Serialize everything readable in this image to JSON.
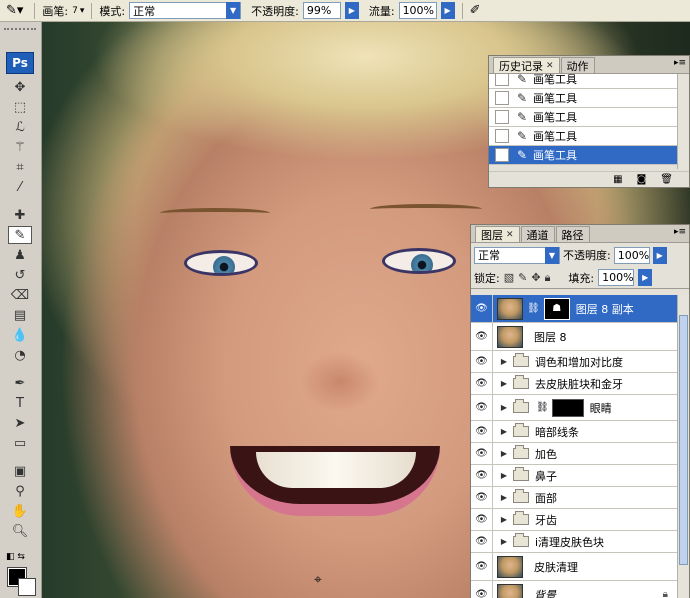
{
  "options_bar": {
    "brush_label": "画笔:",
    "brush_size": "7",
    "mode_label": "模式:",
    "mode_value": "正常",
    "opacity_label": "不透明度:",
    "opacity_value": "99%",
    "flow_label": "流量:",
    "flow_value": "100%"
  },
  "toolbox": {
    "logo": "Ps"
  },
  "history_panel": {
    "tabs": [
      {
        "label": "历史记录",
        "active": true
      },
      {
        "label": "动作",
        "active": false
      }
    ],
    "items": [
      {
        "label": "画笔工具",
        "selected": false
      },
      {
        "label": "画笔工具",
        "selected": false
      },
      {
        "label": "画笔工具",
        "selected": false
      },
      {
        "label": "画笔工具",
        "selected": false
      },
      {
        "label": "画笔工具",
        "selected": true
      }
    ]
  },
  "layers_panel": {
    "tabs": [
      {
        "label": "图层",
        "active": true
      },
      {
        "label": "通道",
        "active": false
      },
      {
        "label": "路径",
        "active": false
      }
    ],
    "blend_mode": "正常",
    "opacity_label": "不透明度:",
    "opacity_value": "100%",
    "lock_label": "锁定:",
    "fill_label": "填充:",
    "fill_value": "100%",
    "layers": [
      {
        "name": "图层 8 副本",
        "kind": "image-masked",
        "selected": true
      },
      {
        "name": "图层 8",
        "kind": "image"
      },
      {
        "name": "调色和增加对比度",
        "kind": "group"
      },
      {
        "name": "去皮肤脏块和金牙",
        "kind": "group"
      },
      {
        "name": "眼睛",
        "kind": "group-masked"
      },
      {
        "name": "暗部线条",
        "kind": "group"
      },
      {
        "name": "加色",
        "kind": "group"
      },
      {
        "name": "鼻子",
        "kind": "group"
      },
      {
        "name": "面部",
        "kind": "group"
      },
      {
        "name": "牙齿",
        "kind": "group"
      },
      {
        "name": "i清理皮肤色块",
        "kind": "group"
      },
      {
        "name": "皮肤清理",
        "kind": "image"
      },
      {
        "name": "背景",
        "kind": "background"
      }
    ]
  },
  "colors": {
    "selection": "#316ac5",
    "panel_bg": "#e4e1d8"
  }
}
